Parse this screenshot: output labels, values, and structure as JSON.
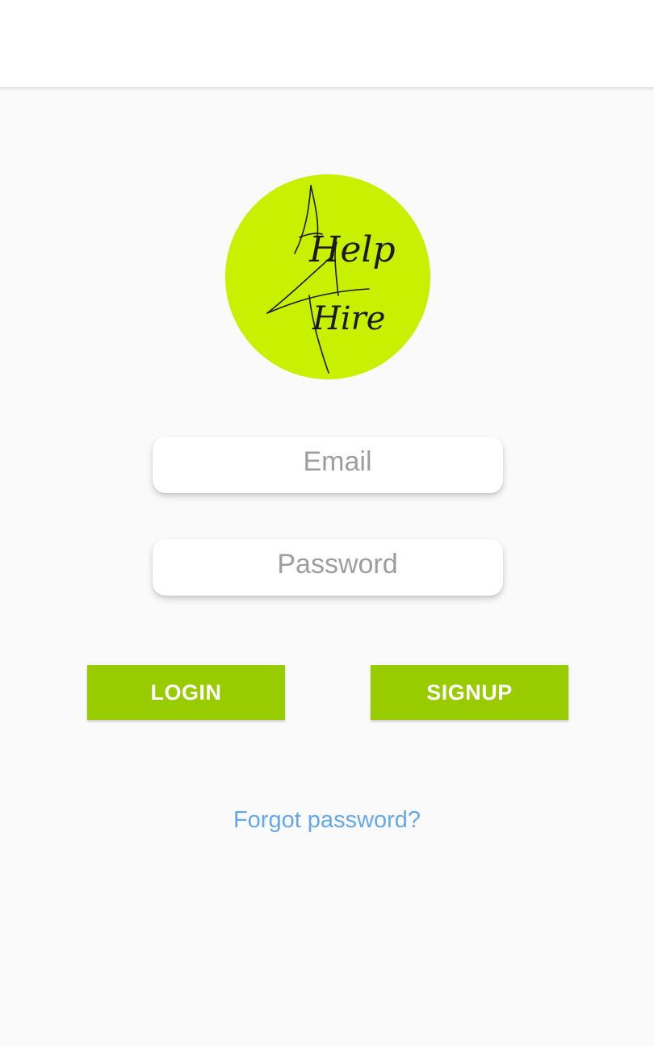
{
  "app_bar": {},
  "logo": {
    "name": "help-4-hire-logo",
    "background_color": "#c8f000",
    "word_top": "Help",
    "word_bottom": "Hire"
  },
  "form": {
    "email": {
      "placeholder": "Email",
      "value": ""
    },
    "password": {
      "placeholder": "Password",
      "value": ""
    }
  },
  "buttons": {
    "login_label": "LOGIN",
    "signup_label": "SIGNUP",
    "color": "#99cc00"
  },
  "links": {
    "forgot_password": "Forgot password?",
    "color": "#64a8ec"
  }
}
